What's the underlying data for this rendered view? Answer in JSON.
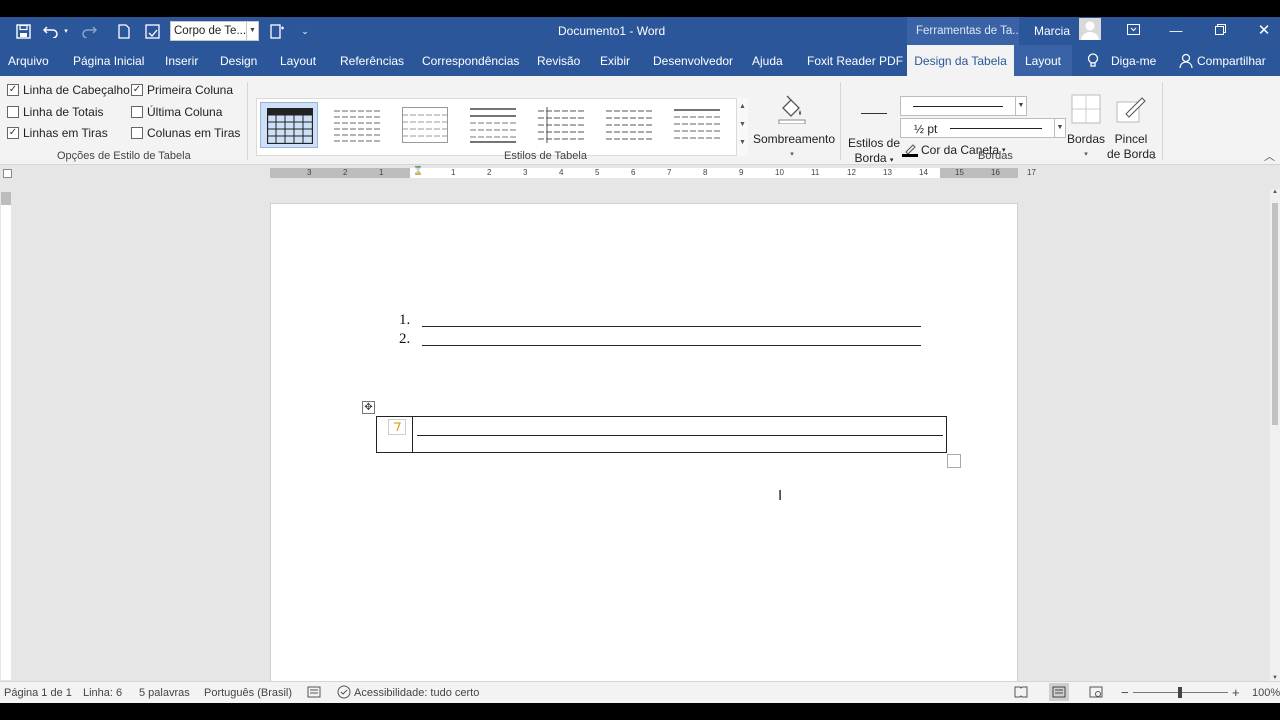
{
  "titlebar": {
    "style_box": "Corpo de Te...",
    "doc_title": "Documento1  -  Word",
    "contextual_group": "Ferramentas de Ta...",
    "user_name": "Marcia"
  },
  "tabs": [
    "Arquivo",
    "Página Inicial",
    "Inserir",
    "Design",
    "Layout",
    "Referências",
    "Correspondências",
    "Revisão",
    "Exibir",
    "Desenvolvedor",
    "Ajuda",
    "Foxit Reader PDF"
  ],
  "contextual_tabs": {
    "design": "Design da Tabela",
    "layout": "Layout"
  },
  "tell_me": "Diga-me",
  "share": "Compartilhar",
  "options": {
    "header_row": "Linha de Cabeçalho",
    "total_row": "Linha de Totais",
    "banded_rows": "Linhas em Tiras",
    "first_column": "Primeira Coluna",
    "last_column": "Última Coluna",
    "banded_columns": "Colunas em Tiras",
    "checked": {
      "header_row": true,
      "total_row": false,
      "banded_rows": true,
      "first_column": true,
      "last_column": false,
      "banded_columns": false
    },
    "group_label": "Opções de Estilo de Tabela"
  },
  "styles_group_label": "Estilos de Tabela",
  "shading_label": "Sombreamento",
  "borders": {
    "border_styles_1": "Estilos de",
    "border_styles_2": "Borda",
    "weight": "½ pt",
    "pen_color": "Cor da Caneta",
    "borders_btn": "Bordas",
    "painter_1": "Pincel",
    "painter_2": "de Borda",
    "group_label": "Bordas"
  },
  "ruler_h": [
    "3",
    "2",
    "1",
    "1",
    "2",
    "3",
    "4",
    "5",
    "6",
    "7",
    "8",
    "9",
    "10",
    "11",
    "12",
    "13",
    "14",
    "15",
    "16",
    "17"
  ],
  "document": {
    "list_numbers": [
      "1.",
      "2."
    ]
  },
  "status": {
    "page": "Página 1 de 1",
    "line": "Linha: 6",
    "words": "5 palavras",
    "language": "Português (Brasil)",
    "accessibility": "Acessibilidade: tudo certo",
    "zoom": "100%"
  },
  "colors": {
    "accent": "#2b579a",
    "ribbon": "#f3f3f3",
    "canvas": "#e6e6e6"
  }
}
